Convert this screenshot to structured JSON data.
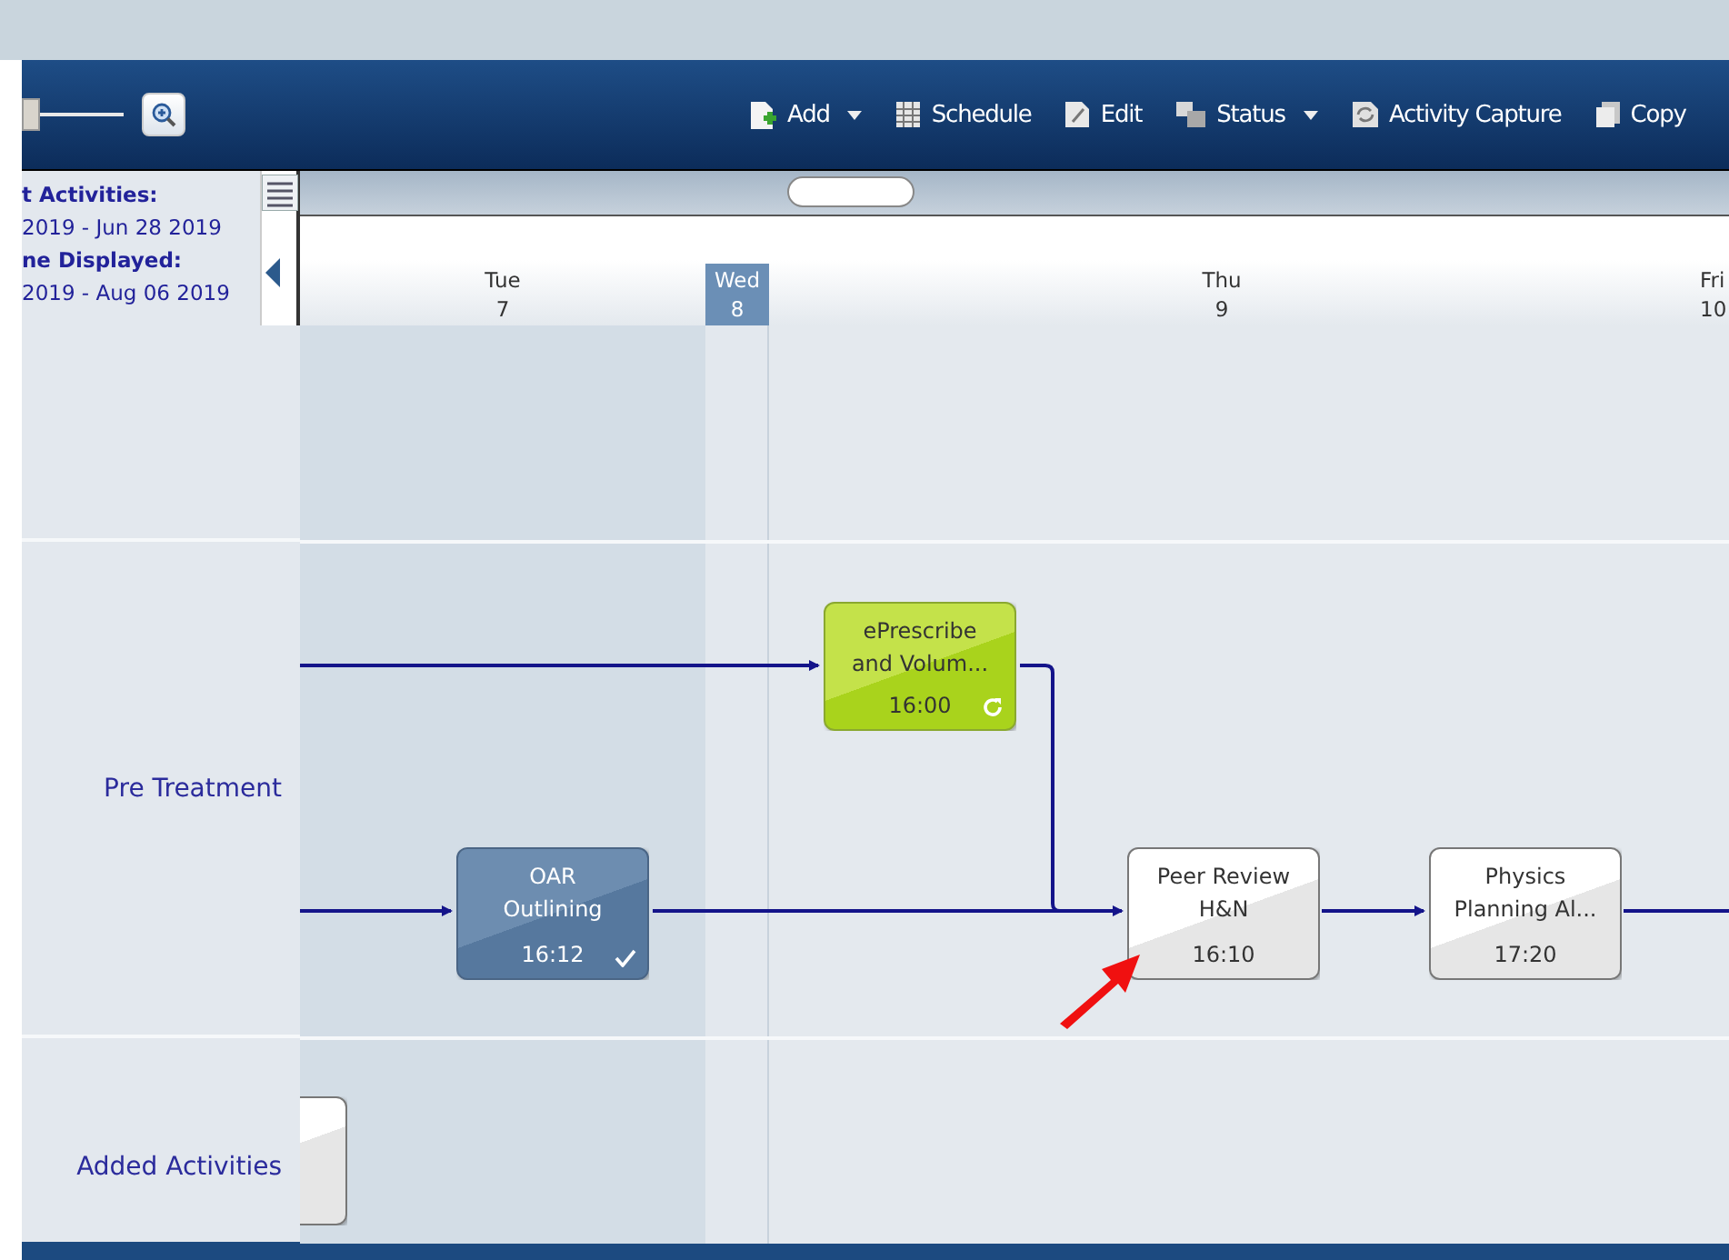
{
  "toolbar": {
    "zoom_slider": {
      "level": 0
    },
    "buttons": [
      {
        "label": "Add",
        "kind": "dropdown"
      },
      {
        "label": "Schedule",
        "kind": "plain"
      },
      {
        "label": "Edit",
        "kind": "plain"
      },
      {
        "label": "Status",
        "kind": "dropdown"
      },
      {
        "label": "Activity Capture",
        "kind": "plain"
      },
      {
        "label": "Copy",
        "kind": "plain"
      }
    ]
  },
  "schedule_info": [
    {
      "kind": "heading",
      "text": "t Activities:"
    },
    {
      "kind": "range",
      "text": "2019 - Jun 28 2019"
    },
    {
      "kind": "heading",
      "text": "ne Displayed:"
    },
    {
      "kind": "range",
      "text": "2019 - Aug 06 2019"
    }
  ],
  "days": [
    {
      "day": "Tue",
      "date": "7",
      "selected": false
    },
    {
      "day": "Wed",
      "date": "8",
      "selected": true
    },
    {
      "day": "Thu",
      "date": "9",
      "selected": false
    },
    {
      "day": "Fri",
      "date": "10",
      "selected": false
    }
  ],
  "lanes": [
    {
      "label": "Pre Treatment"
    },
    {
      "label": "Added Activities"
    }
  ],
  "activities": [
    {
      "title_lines": [
        "ePrescribe",
        "and Volum..."
      ],
      "time": "16:00",
      "kind": "in_progress"
    },
    {
      "title_lines": [
        "OAR",
        "Outlining"
      ],
      "time": "16:12",
      "kind": "completed"
    },
    {
      "title_lines": [
        "Peer Review",
        "H&N"
      ],
      "time": "16:10",
      "kind": "scheduled"
    },
    {
      "title_lines": [
        "Physics",
        "Planning Al..."
      ],
      "time": "17:20",
      "kind": "scheduled"
    },
    {
      "kind": "scheduled"
    }
  ]
}
